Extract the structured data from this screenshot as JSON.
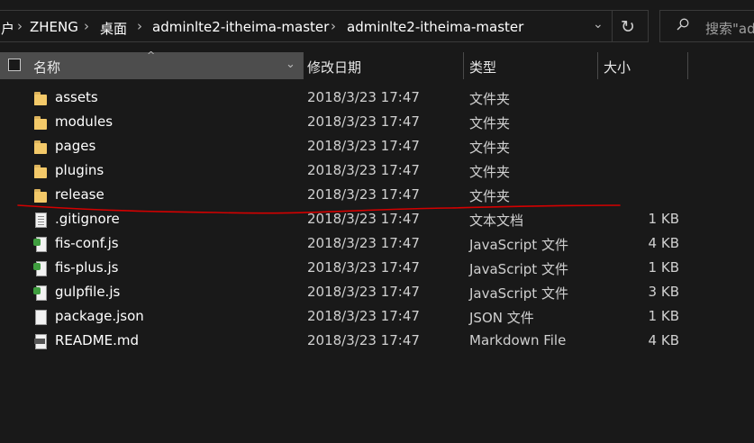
{
  "breadcrumb": {
    "items": [
      "户",
      "ZHENG",
      "桌面",
      "adminlte2-itheima-master",
      "adminlte2-itheima-master"
    ]
  },
  "search": {
    "placeholder": "搜索\"ad"
  },
  "columns": {
    "name": "名称",
    "date": "修改日期",
    "type": "类型",
    "size": "大小"
  },
  "files": [
    {
      "name": "assets",
      "date": "2018/3/23 17:47",
      "type": "文件夹",
      "size": "",
      "icon": "folder-icon"
    },
    {
      "name": "modules",
      "date": "2018/3/23 17:47",
      "type": "文件夹",
      "size": "",
      "icon": "folder-icon"
    },
    {
      "name": "pages",
      "date": "2018/3/23 17:47",
      "type": "文件夹",
      "size": "",
      "icon": "folder-icon"
    },
    {
      "name": "plugins",
      "date": "2018/3/23 17:47",
      "type": "文件夹",
      "size": "",
      "icon": "folder-icon"
    },
    {
      "name": "release",
      "date": "2018/3/23 17:47",
      "type": "文件夹",
      "size": "",
      "icon": "folder-icon"
    },
    {
      "name": ".gitignore",
      "date": "2018/3/23 17:47",
      "type": "文本文档",
      "size": "1 KB",
      "icon": "text-file-icon"
    },
    {
      "name": "fis-conf.js",
      "date": "2018/3/23 17:47",
      "type": "JavaScript 文件",
      "size": "4 KB",
      "icon": "js-file-icon"
    },
    {
      "name": "fis-plus.js",
      "date": "2018/3/23 17:47",
      "type": "JavaScript 文件",
      "size": "1 KB",
      "icon": "js-file-icon"
    },
    {
      "name": "gulpfile.js",
      "date": "2018/3/23 17:47",
      "type": "JavaScript 文件",
      "size": "3 KB",
      "icon": "js-file-icon"
    },
    {
      "name": "package.json",
      "date": "2018/3/23 17:47",
      "type": "JSON 文件",
      "size": "1 KB",
      "icon": "json-file-icon"
    },
    {
      "name": "README.md",
      "date": "2018/3/23 17:47",
      "type": "Markdown File",
      "size": "4 KB",
      "icon": "markdown-file-icon"
    }
  ],
  "colors": {
    "background": "#191919",
    "header_selected": "#4d4d4d",
    "annotation": "#d40000"
  }
}
